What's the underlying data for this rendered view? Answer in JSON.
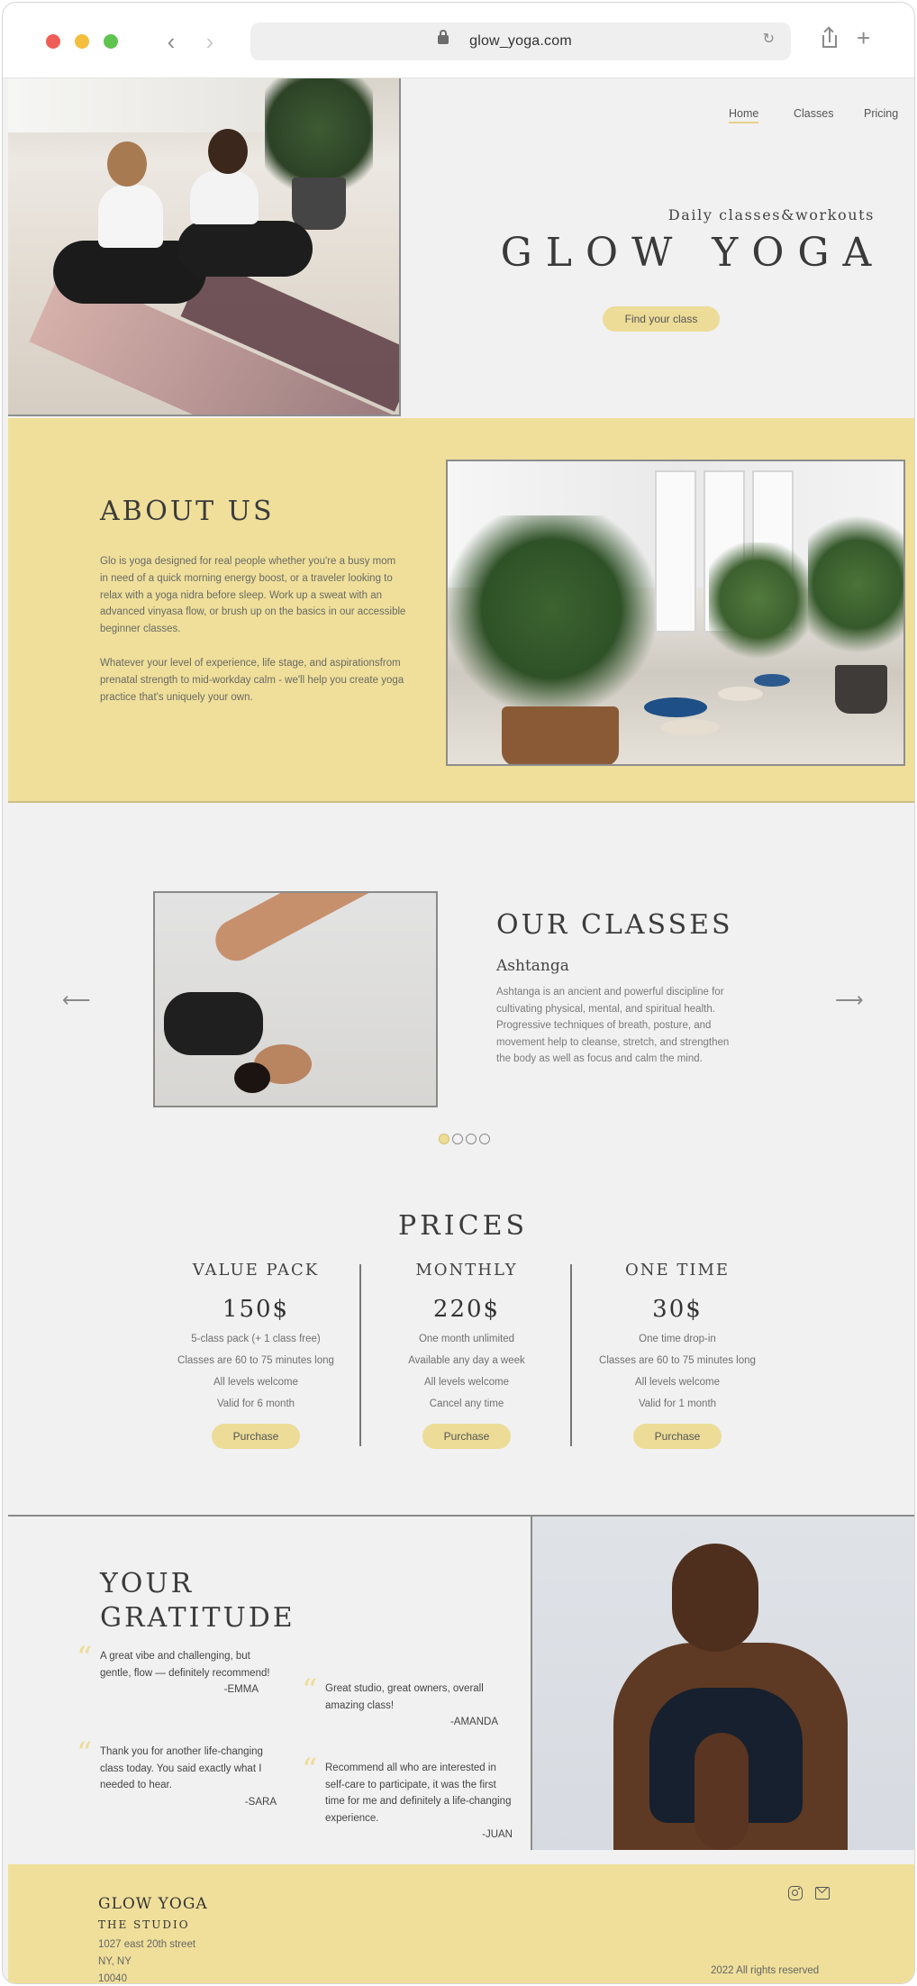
{
  "browser": {
    "url": "glow_yoga.com",
    "back_glyph": "‹",
    "forward_glyph": "›",
    "reload_glyph": "↻",
    "new_tab_glyph": "+"
  },
  "nav": {
    "home": "Home",
    "classes": "Classes",
    "pricing": "Pricing"
  },
  "hero": {
    "subtitle": "Daily classes&workouts",
    "title": "GLOW YOGA",
    "cta": "Find your class"
  },
  "about": {
    "title": "ABOUT US",
    "paragraph1": "Glo is yoga designed for real people whether you're a busy mom in need of a quick morning energy boost, or a traveler looking to relax with a yoga nidra before sleep. Work up a sweat with an advanced vinyasa flow, or brush up on the basics in our accessible beginner classes.",
    "paragraph2": "Whatever your level of experience, life stage, and aspirationsfrom prenatal strength to mid-workday calm - we'll help you create yoga practice that's uniquely your own."
  },
  "classes": {
    "title": "OUR CLASSES",
    "name": "Ashtanga",
    "description": "Ashtanga is an ancient and powerful discipline for cultivating physical, mental, and spiritual health. Progressive techniques of breath, posture, and movement help to cleanse, stretch, and strengthen the body as well as focus and calm the mind.",
    "prev_glyph": "⟵",
    "next_glyph": "⟶",
    "slide_count": 4,
    "active_slide": 1
  },
  "prices": {
    "title": "PRICES",
    "plans": [
      {
        "name": "VALUE PACK",
        "price": "150$",
        "features": [
          "5-class pack (+ 1 class free)",
          "Classes are 60 to 75 minutes long",
          "All levels welcome",
          "Valid for 6 month"
        ],
        "button": "Purchase"
      },
      {
        "name": "MONTHLY",
        "price": "220$",
        "features": [
          "One month unlimited",
          "Available any day a week",
          "All levels welcome",
          "Cancel any time"
        ],
        "button": "Purchase"
      },
      {
        "name": "ONE TIME",
        "price": "30$",
        "features": [
          "One time drop-in",
          "Classes are 60 to 75 minutes long",
          "All levels welcome",
          "Valid for 1 month"
        ],
        "button": "Purchase"
      }
    ]
  },
  "gratitude": {
    "title_line1": "YOUR",
    "title_line2": "GRATITUDE",
    "quotes": [
      {
        "text": "A great vibe and challenging, but gentle, flow — definitely recommend!",
        "author": "-EMMA"
      },
      {
        "text": "Great studio, great owners, overall amazing class!",
        "author": "-AMANDA"
      },
      {
        "text": "Thank you for another life-changing class today. You said exactly what I needed to hear.",
        "author": "-SARA"
      },
      {
        "text": "Recommend all who are interested in self-care to participate, it was the first time for me and definitely a life-changing experience.",
        "author": "-JUAN"
      }
    ],
    "quote_glyph": "“"
  },
  "footer": {
    "brand": "GLOW YOGA",
    "studio": "THE STUDIO",
    "address_line1": "1027 east 20th street",
    "address_line2": "NY, NY",
    "address_line3": "10040",
    "rights": "2022 All rights reserved"
  },
  "colors": {
    "accent_yellow": "#efdf9a",
    "button_yellow": "#ecdc97",
    "page_background": "#f1f1f1"
  }
}
